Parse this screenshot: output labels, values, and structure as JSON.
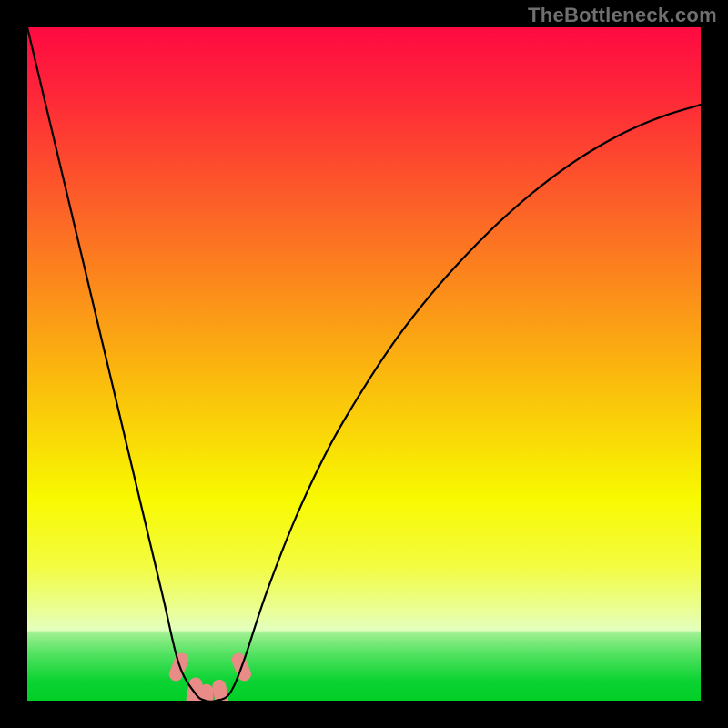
{
  "watermark": "TheBottleneck.com",
  "chart_data": {
    "type": "line",
    "title": "",
    "xlabel": "",
    "ylabel": "",
    "xlim": [
      0,
      1
    ],
    "ylim": [
      0,
      1
    ],
    "series": [
      {
        "name": "bottleneck-curve",
        "x": [
          0.0,
          0.05,
          0.1,
          0.15,
          0.2,
          0.225,
          0.25,
          0.265,
          0.28,
          0.3,
          0.32,
          0.355,
          0.4,
          0.45,
          0.5,
          0.55,
          0.6,
          0.65,
          0.7,
          0.75,
          0.8,
          0.85,
          0.9,
          0.95,
          1.0
        ],
        "y": [
          1.0,
          0.79,
          0.58,
          0.37,
          0.16,
          0.055,
          0.01,
          0.0,
          0.0,
          0.01,
          0.055,
          0.16,
          0.275,
          0.38,
          0.465,
          0.54,
          0.604,
          0.66,
          0.71,
          0.754,
          0.792,
          0.824,
          0.85,
          0.87,
          0.885
        ]
      }
    ],
    "markers": {
      "name": "highlight-pills",
      "x": [
        0.225,
        0.248,
        0.266,
        0.287,
        0.318
      ],
      "y": [
        0.05,
        0.013,
        0.003,
        0.01,
        0.05
      ],
      "color": "#e98b86"
    },
    "gradient_stops": [
      {
        "offset": 0.0,
        "color": "#fe0a42"
      },
      {
        "offset": 0.1,
        "color": "#fe2738"
      },
      {
        "offset": 0.3,
        "color": "#fc6d24"
      },
      {
        "offset": 0.5,
        "color": "#fbb30f"
      },
      {
        "offset": 0.7,
        "color": "#f8f900"
      },
      {
        "offset": 0.8,
        "color": "#f3fc41"
      },
      {
        "offset": 0.86,
        "color": "#eafe8e"
      },
      {
        "offset": 0.895,
        "color": "#e4ffbe"
      },
      {
        "offset": 0.9,
        "color": "#9cf090"
      },
      {
        "offset": 0.93,
        "color": "#54e262"
      },
      {
        "offset": 0.97,
        "color": "#0cd333"
      },
      {
        "offset": 1.0,
        "color": "#00cf27"
      }
    ]
  }
}
